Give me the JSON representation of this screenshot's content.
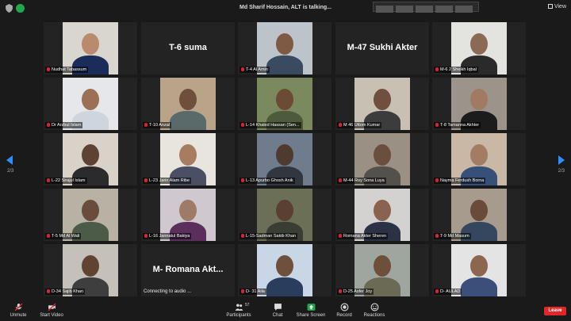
{
  "topbar": {
    "speaking_text": "Md Sharif Hossain, ALT is talking...",
    "view_label": "View"
  },
  "pagination": {
    "left": "2/3",
    "right": "2/3"
  },
  "tiles": [
    {
      "name": "Nudhat Tabassum",
      "type": "video",
      "bg": "#d9d6cf",
      "skin": "#b98a6c",
      "shirt": "#1a2d5a"
    },
    {
      "name": "T-6 suma",
      "type": "name"
    },
    {
      "name": "T-4 Al Amin",
      "type": "video",
      "bg": "#bcc3c9",
      "skin": "#7e5a45",
      "shirt": "#3a4b60"
    },
    {
      "name": "M-47 Sukhi Akter",
      "type": "name"
    },
    {
      "name": "M-6 2 Sheikh Iqbal",
      "type": "video",
      "bg": "#e3e3e0",
      "skin": "#8a6a55",
      "shirt": "#2a2a2a"
    },
    {
      "name": "Dr Arzbul Islam",
      "type": "video",
      "bg": "#e5e7ea",
      "skin": "#9b7055",
      "shirt": "#cfd5dd"
    },
    {
      "name": "T-10 Anzal",
      "type": "video",
      "bg": "#b9a489",
      "skin": "#6e4f3c",
      "shirt": "#5a6a6a"
    },
    {
      "name": "L-14 Khaled Hassan (Sen...",
      "type": "video",
      "bg": "#7b8a5e",
      "skin": "#6b4b36",
      "shirt": "#4d5b3a"
    },
    {
      "name": "M 46 Uttom Kumar",
      "type": "video",
      "bg": "#c7c0b3",
      "skin": "#6f4f3e",
      "shirt": "#3c3c3c"
    },
    {
      "name": "T-8 Tamanna Akhter",
      "type": "video",
      "bg": "#9c938b",
      "skin": "#a07a62",
      "shirt": "#1c1c1c"
    },
    {
      "name": "L-22 Sirajul Islam",
      "type": "video",
      "bg": "#d8d2c8",
      "skin": "#5e4233",
      "shirt": "#2b2b2b"
    },
    {
      "name": "L-23 Jarin Alam Ribe",
      "type": "video",
      "bg": "#e8e4de",
      "skin": "#a77c61",
      "shirt": "#4a4f66"
    },
    {
      "name": "L-13 Apurbo Ghosh Anik",
      "type": "video",
      "bg": "#6e7c8e",
      "skin": "#4e3a2e",
      "shirt": "#31363f"
    },
    {
      "name": "M-44 Roy Sona Luya",
      "type": "video",
      "bg": "#9a9184",
      "skin": "#6a4e3e",
      "shirt": "#52514c"
    },
    {
      "name": "Nayma Ferdush Borna",
      "type": "video",
      "bg": "#c9b8a6",
      "skin": "#a27c63",
      "shirt": "#36507a"
    },
    {
      "name": "T-5 Md Al Wali",
      "type": "video",
      "bg": "#b7b2a4",
      "skin": "#6a4c3c",
      "shirt": "#4c5a48"
    },
    {
      "name": "L-16 Jannatul Bakiya",
      "type": "video",
      "bg": "#cfc8cf",
      "skin": "#9d7b66",
      "shirt": "#5b2f5c"
    },
    {
      "name": "L-15-Sadman Sakib Khan",
      "type": "video",
      "bg": "#6a6f55",
      "skin": "#5a4032",
      "shirt": "#3a3d33"
    },
    {
      "name": "Romana Akter Sheren",
      "type": "video",
      "bg": "#d4d2d0",
      "skin": "#8a6350",
      "shirt": "#2b3245"
    },
    {
      "name": "T-9 Md Masum",
      "type": "video",
      "bg": "#a69b8c",
      "skin": "#6a4a38",
      "shirt": "#35475e"
    },
    {
      "name": "D-34 Sajib Khan",
      "type": "video",
      "bg": "#c5c1ba",
      "skin": "#5f4433",
      "shirt": "#3e3e3e"
    },
    {
      "name": "M- Romana Akt...",
      "type": "name",
      "status": "Connecting to audio ..."
    },
    {
      "name": "D- 31 Aila",
      "type": "video",
      "bg": "#c9d6e6",
      "skin": "#6e503d",
      "shirt": "#2a3d5c"
    },
    {
      "name": "D-25 Asfer Joy",
      "type": "video",
      "bg": "#9fa6a0",
      "skin": "#6e4f3a",
      "shirt": "#6b6b55"
    },
    {
      "name": "D- AULAD",
      "type": "video",
      "bg": "#e4e4e4",
      "skin": "#8d6650",
      "shirt": "#3a4f7a"
    }
  ],
  "toolbar": {
    "unmute": "Unmute",
    "start_video": "Start Video",
    "participants": "Participants",
    "participant_count": "57",
    "chat": "Chat",
    "share_screen": "Share Screen",
    "record": "Record",
    "reactions": "Reactions",
    "leave": "Leave"
  },
  "colors": {
    "accent": "#2d8cff",
    "share_green": "#22a84a",
    "leave_red": "#e02828"
  }
}
